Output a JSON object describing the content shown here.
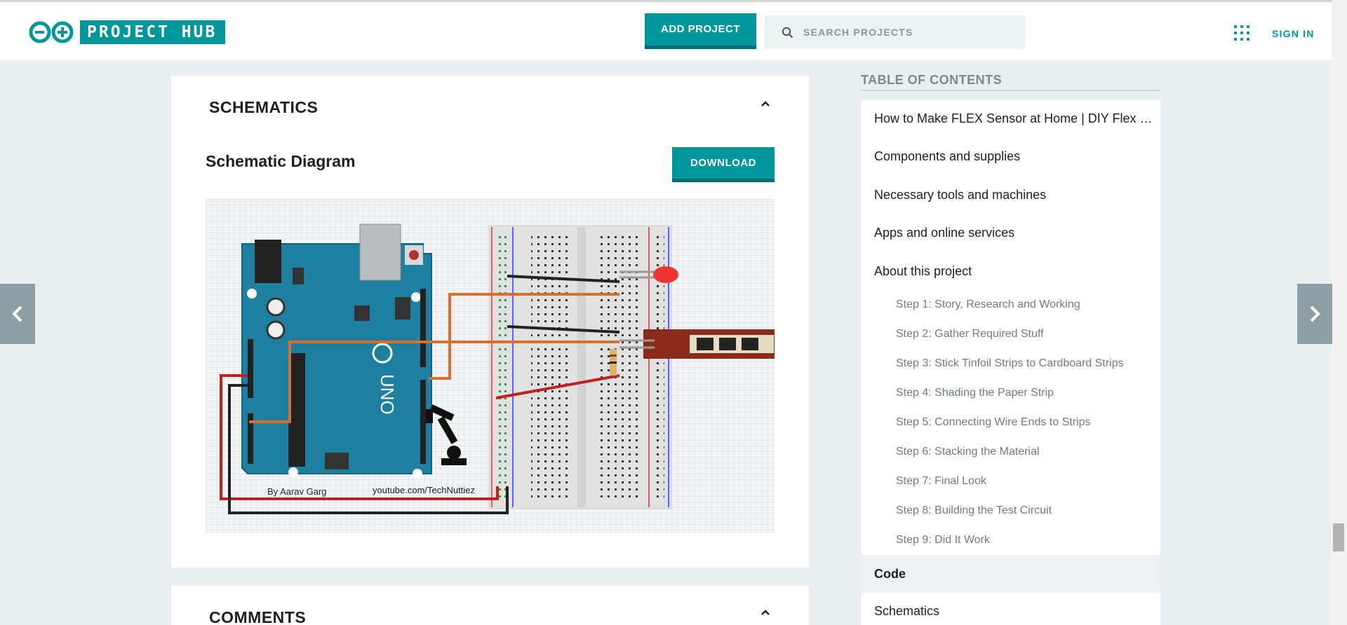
{
  "header": {
    "logo_text": "PROJECT HUB",
    "add_project_label": "ADD PROJECT",
    "search_placeholder": "SEARCH PROJECTS",
    "signin_label": "SIGN IN"
  },
  "schematics": {
    "section_title": "SCHEMATICS",
    "diagram_title": "Schematic Diagram",
    "download_label": "DOWNLOAD",
    "author_caption": "By Aarav Garg",
    "channel_caption": "youtube.com/TechNuttiez"
  },
  "comments": {
    "section_title": "COMMENTS"
  },
  "toc": {
    "title": "TABLE OF CONTENTS",
    "items": [
      "How to Make FLEX Sensor at Home | DIY Flex Sensor",
      "Components and supplies",
      "Necessary tools and machines",
      "Apps and online services",
      "About this project"
    ],
    "steps": [
      "Step 1: Story, Research and Working",
      "Step 2: Gather Required Stuff",
      "Step 3: Stick Tinfoil Strips to Cardboard Strips",
      "Step 4: Shading the Paper Strip",
      "Step 5: Connecting Wire Ends to Strips",
      "Step 6: Stacking the Material",
      "Step 7: Final Look",
      "Step 8: Building the Test Circuit",
      "Step 9: Did It Work"
    ],
    "active_item": "Code",
    "last_item": "Schematics"
  },
  "colors": {
    "brand": "#00979c",
    "brand_dark": "#006c70",
    "page_bg": "#e9eef0",
    "arduino_board": "#1f7fa0"
  }
}
